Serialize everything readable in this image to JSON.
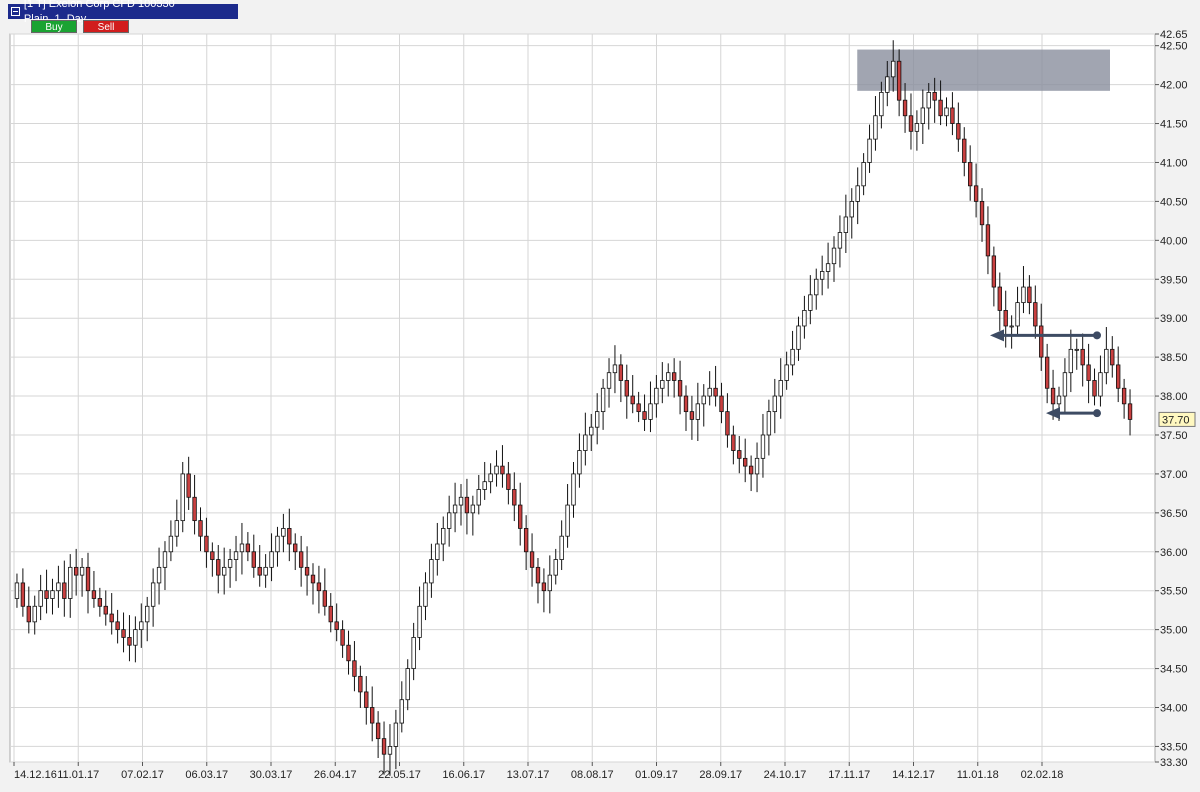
{
  "header": {
    "title": "[1 T] Exelon Corp CFD  100330 Plain_1_Day",
    "buy_label": "Buy",
    "sell_label": "Sell"
  },
  "colors": {
    "up": "#ffffff",
    "down": "#c94040",
    "wick": "#111111",
    "zone": "#8a8f9e",
    "arrow": "#3d4b63",
    "grid": "#d6d6d6"
  },
  "chart_data": {
    "type": "candlestick",
    "instrument": "Exelon Corp CFD",
    "timeframe": "1 Day",
    "ylim": [
      33.3,
      42.65
    ],
    "y_ticks": [
      "33.30",
      "33.50",
      "34.00",
      "34.50",
      "35.00",
      "35.50",
      "36.00",
      "36.50",
      "37.00",
      "37.50",
      "38.00",
      "38.50",
      "39.00",
      "39.50",
      "40.00",
      "40.50",
      "41.00",
      "41.50",
      "42.00",
      "42.50",
      "42.65"
    ],
    "x_ticks": [
      "14.12.16",
      "11.01.17",
      "07.02.17",
      "06.03.17",
      "30.03.17",
      "26.04.17",
      "22.05.17",
      "16.06.17",
      "13.07.17",
      "08.08.17",
      "01.09.17",
      "28.09.17",
      "24.10.17",
      "17.11.17",
      "14.12.17",
      "11.01.18",
      "02.02.18"
    ],
    "last_price_label": "37.70",
    "last_price": 37.7,
    "zone": {
      "from": "17.11.17",
      "low": 41.92,
      "high": 42.45
    },
    "arrows": [
      {
        "price": 38.78
      },
      {
        "price": 37.78
      }
    ],
    "closes": [
      35.6,
      35.3,
      35.1,
      35.3,
      35.5,
      35.4,
      35.5,
      35.6,
      35.4,
      35.8,
      35.7,
      35.8,
      35.5,
      35.4,
      35.3,
      35.2,
      35.1,
      35.0,
      34.9,
      34.8,
      35.0,
      35.1,
      35.3,
      35.6,
      35.8,
      36.0,
      36.2,
      36.4,
      37.0,
      36.7,
      36.4,
      36.2,
      36.0,
      35.9,
      35.7,
      35.8,
      35.9,
      36.0,
      36.1,
      36.0,
      35.8,
      35.7,
      35.8,
      36.0,
      36.2,
      36.3,
      36.1,
      36.0,
      35.8,
      35.7,
      35.6,
      35.5,
      35.3,
      35.1,
      35.0,
      34.8,
      34.6,
      34.4,
      34.2,
      34.0,
      33.8,
      33.6,
      33.4,
      33.5,
      33.8,
      34.1,
      34.5,
      34.9,
      35.3,
      35.6,
      35.9,
      36.1,
      36.3,
      36.5,
      36.6,
      36.7,
      36.5,
      36.6,
      36.8,
      36.9,
      37.0,
      37.1,
      37.0,
      36.8,
      36.6,
      36.3,
      36.0,
      35.8,
      35.6,
      35.5,
      35.7,
      35.9,
      36.2,
      36.6,
      37.0,
      37.3,
      37.5,
      37.6,
      37.8,
      38.1,
      38.3,
      38.4,
      38.2,
      38.0,
      37.9,
      37.8,
      37.7,
      37.9,
      38.1,
      38.2,
      38.3,
      38.2,
      38.0,
      37.8,
      37.7,
      37.9,
      38.0,
      38.1,
      38.0,
      37.8,
      37.5,
      37.3,
      37.2,
      37.1,
      37.0,
      37.2,
      37.5,
      37.8,
      38.0,
      38.2,
      38.4,
      38.6,
      38.9,
      39.1,
      39.3,
      39.5,
      39.6,
      39.7,
      39.9,
      40.1,
      40.3,
      40.5,
      40.7,
      41.0,
      41.3,
      41.6,
      41.9,
      42.1,
      42.3,
      41.8,
      41.6,
      41.4,
      41.5,
      41.7,
      41.9,
      41.8,
      41.6,
      41.7,
      41.5,
      41.3,
      41.0,
      40.7,
      40.5,
      40.2,
      39.8,
      39.4,
      39.1,
      38.9,
      38.9,
      39.2,
      39.4,
      39.2,
      38.9,
      38.5,
      38.1,
      37.9,
      38.0,
      38.3,
      38.6,
      38.6,
      38.4,
      38.2,
      38.0,
      38.3,
      38.6,
      38.4,
      38.1,
      37.9,
      37.7
    ]
  }
}
